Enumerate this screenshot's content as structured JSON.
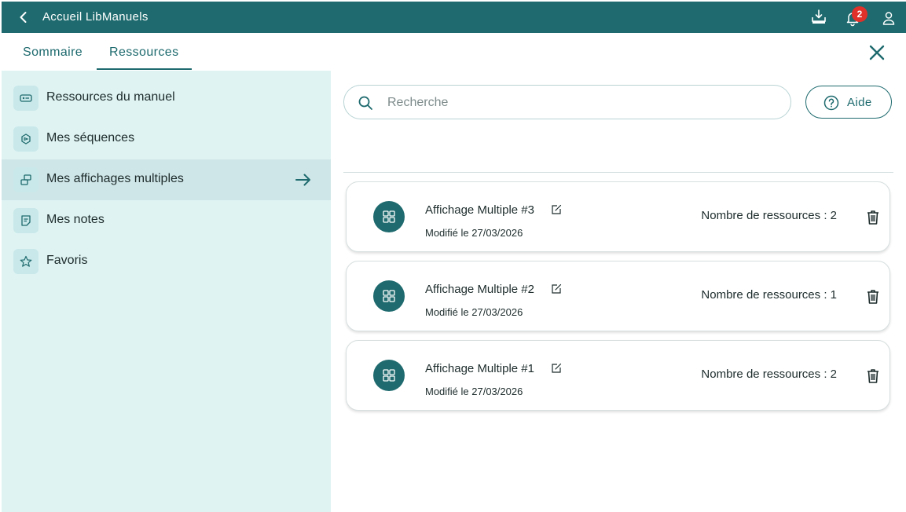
{
  "topbar": {
    "title": "Accueil LibManuels",
    "notification_count": "2",
    "icons": [
      "back-icon",
      "download-icon",
      "bell-icon",
      "user-icon"
    ]
  },
  "tabs": [
    {
      "label": "Sommaire",
      "active": false
    },
    {
      "label": "Ressources",
      "active": true
    }
  ],
  "sidebar": {
    "items": [
      {
        "label": "Ressources du manuel",
        "icon": "resource-icon",
        "active": false
      },
      {
        "label": "Mes séquences",
        "icon": "sequence-icon",
        "active": false
      },
      {
        "label": "Mes affichages multiples",
        "icon": "multi-display-icon",
        "active": true
      },
      {
        "label": "Mes notes",
        "icon": "note-icon",
        "active": false
      },
      {
        "label": "Favoris",
        "icon": "star-icon",
        "active": false
      }
    ]
  },
  "search": {
    "placeholder": "Recherche",
    "value": ""
  },
  "help": {
    "label": "Aide"
  },
  "cards": [
    {
      "title": "Affichage Multiple #3",
      "date": "Modifié le 27/03/2026",
      "count": "Nombre de ressources : 2"
    },
    {
      "title": "Affichage Multiple #2",
      "date": "Modifié le 27/03/2026",
      "count": "Nombre de ressources : 1"
    },
    {
      "title": "Affichage Multiple #1",
      "date": "Modifié le 27/03/2026",
      "count": "Nombre de ressources : 2"
    }
  ],
  "colors": {
    "primary": "#1e6a6e",
    "sidebar_bg": "#dff3f3",
    "sidebar_active": "#cfe6e8",
    "badge": "#e0302a"
  }
}
